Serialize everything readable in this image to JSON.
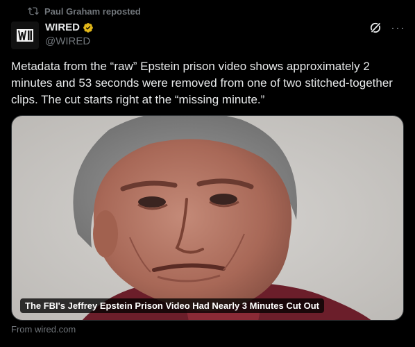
{
  "repost": {
    "icon": "repost-icon",
    "text": "Paul Graham reposted"
  },
  "author": {
    "avatar_icon": "wired-logo",
    "name": "WIRED",
    "verified_icon": "verified-badge-icon",
    "handle": "@WIRED"
  },
  "actions": {
    "grok_icon": "grok-icon",
    "more_label": "···"
  },
  "tweet": {
    "text": "Metadata from the “raw” Epstein prison video shows approximately 2 minutes and 53 seconds were removed from one of two stitched-together clips. The cut starts right at the “missing minute.”"
  },
  "card": {
    "image_alt": "photo",
    "caption": "The FBI's Jeffrey Epstein Prison Video Had Nearly 3 Minutes Cut Out"
  },
  "source": {
    "text": "From wired.com"
  },
  "colors": {
    "background": "#000000",
    "text": "#e7e9ea",
    "muted": "#71767b",
    "verified_gold": "#e2b719"
  }
}
